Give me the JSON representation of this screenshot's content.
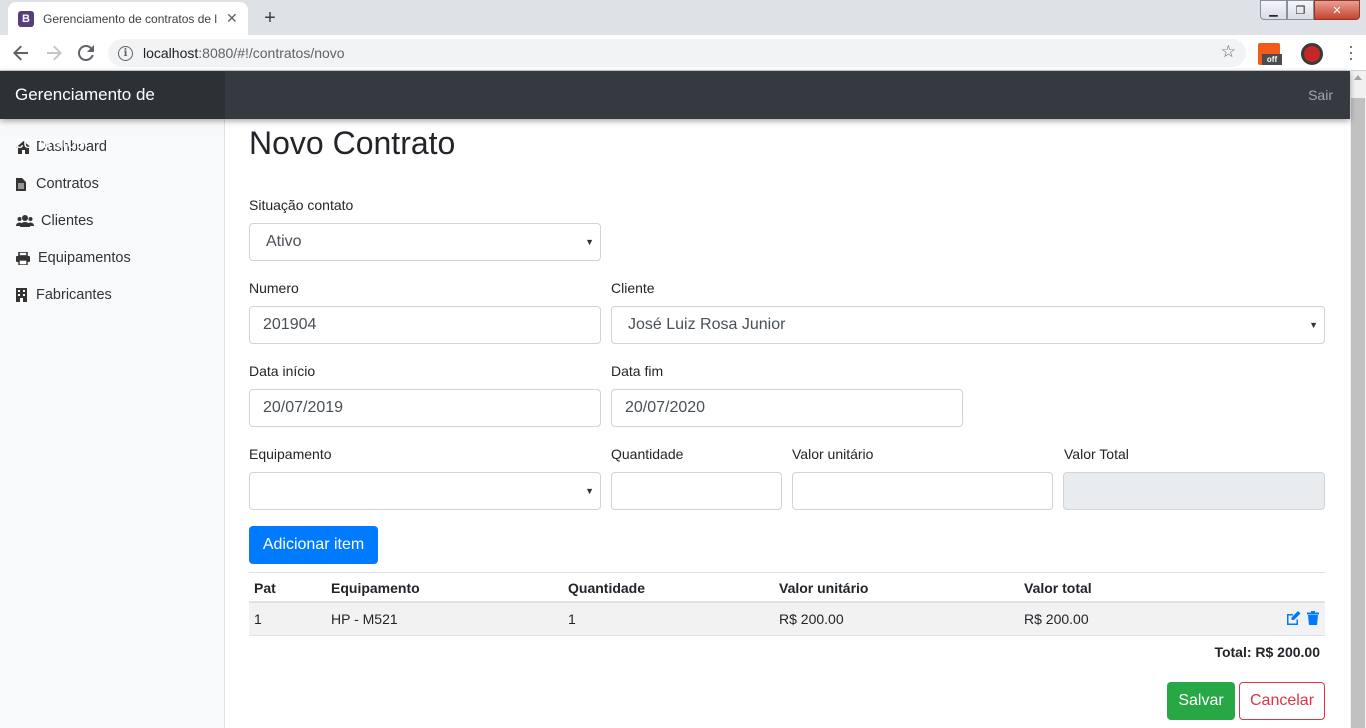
{
  "browser": {
    "tab_title": "Gerenciamento de contratos de l",
    "tab_favicon_letter": "B",
    "url_host": "localhost",
    "url_path": ":8080/#!/contratos/novo",
    "extension_badge": "off",
    "accent_color": "#1a73e8"
  },
  "navbar": {
    "brand": "Gerenciamento de contratos",
    "signout": "Sair"
  },
  "sidebar": {
    "items": [
      {
        "label": "Dashboard",
        "icon": "home-icon"
      },
      {
        "label": "Contratos",
        "icon": "file-icon"
      },
      {
        "label": "Clientes",
        "icon": "users-icon"
      },
      {
        "label": "Equipamentos",
        "icon": "print-icon"
      },
      {
        "label": "Fabricantes",
        "icon": "building-icon"
      }
    ]
  },
  "form": {
    "title": "Novo Contrato",
    "situacao": {
      "label": "Situação contato",
      "value": "Ativo"
    },
    "numero": {
      "label": "Numero",
      "value": "201904"
    },
    "cliente": {
      "label": "Cliente",
      "value": "José Luiz Rosa Junior"
    },
    "data_inicio": {
      "label": "Data início",
      "value": "20/07/2019"
    },
    "data_fim": {
      "label": "Data fim",
      "value": "20/07/2020"
    },
    "equipamento": {
      "label": "Equipamento",
      "value": ""
    },
    "quantidade": {
      "label": "Quantidade",
      "value": ""
    },
    "valor_unitario": {
      "label": "Valor unitário",
      "value": ""
    },
    "valor_total": {
      "label": "Valor Total",
      "value": ""
    },
    "add_button": "Adicionar item"
  },
  "table": {
    "headers": [
      "Pat",
      "Equipamento",
      "Quantidade",
      "Valor unitário",
      "Valor total"
    ],
    "rows": [
      {
        "pat": "1",
        "equipamento": "HP - M521",
        "quantidade": "1",
        "valor_unitario": "R$ 200.00",
        "valor_total": "R$ 200.00"
      }
    ],
    "total": "Total: R$ 200.00"
  },
  "actions": {
    "save": "Salvar",
    "cancel": "Cancelar"
  },
  "colors": {
    "primary": "#007bff",
    "success": "#28a745",
    "danger": "#dc3545",
    "navbar": "#343a40"
  }
}
